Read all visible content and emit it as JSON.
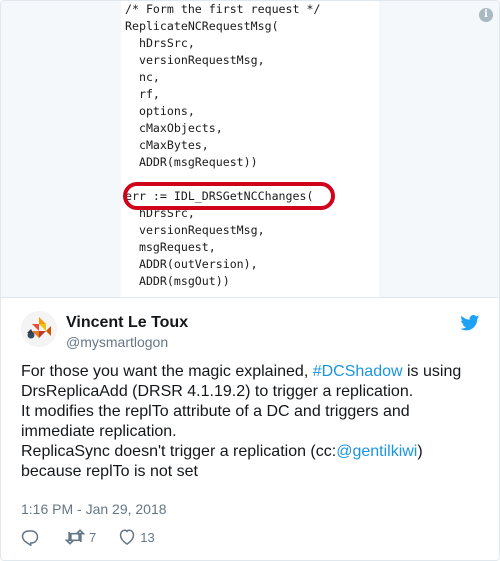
{
  "media": {
    "code_lines": [
      "/* Form the first request */",
      "ReplicateNCRequestMsg(",
      "  hDrsSrc,",
      "  versionRequestMsg,",
      "  nc,",
      "  rf,",
      "  options,",
      "  cMaxObjects,",
      "  cMaxBytes,",
      "  ADDR(msgRequest))",
      "",
      "err := IDL_DRSGetNCChanges(",
      "  hDrsSrc,",
      "  versionRequestMsg,",
      "  msgRequest,",
      "  ADDR(outVersion),",
      "  ADDR(msgOut))"
    ],
    "info_icon": "info-icon",
    "highlight_color": "#d0021b"
  },
  "tweet": {
    "author_name": "Vincent Le Toux",
    "author_handle": "@mysmartlogon",
    "text": {
      "line1_pre": "For those you want the magic explained, ",
      "line1_link": "#DCShadow",
      "line1_post": " is using",
      "line2": "DrsReplicaAdd (DRSR 4.1.19.2) to trigger a replication.",
      "line3": "It modifies the replTo attribute of a DC and triggers and",
      "line4": "immediate replication.",
      "line5_pre": "ReplicaSync doesn't trigger a replication (cc:",
      "line5_link": "@gentilkiwi",
      "line5_post": ")",
      "line6": "because replTo is not set"
    },
    "timestamp": "1:16 PM - Jan 29, 2018",
    "retweets": "7",
    "likes": "13",
    "link_color": "#1b95e0",
    "brand_icon": "twitter-bird-icon"
  }
}
